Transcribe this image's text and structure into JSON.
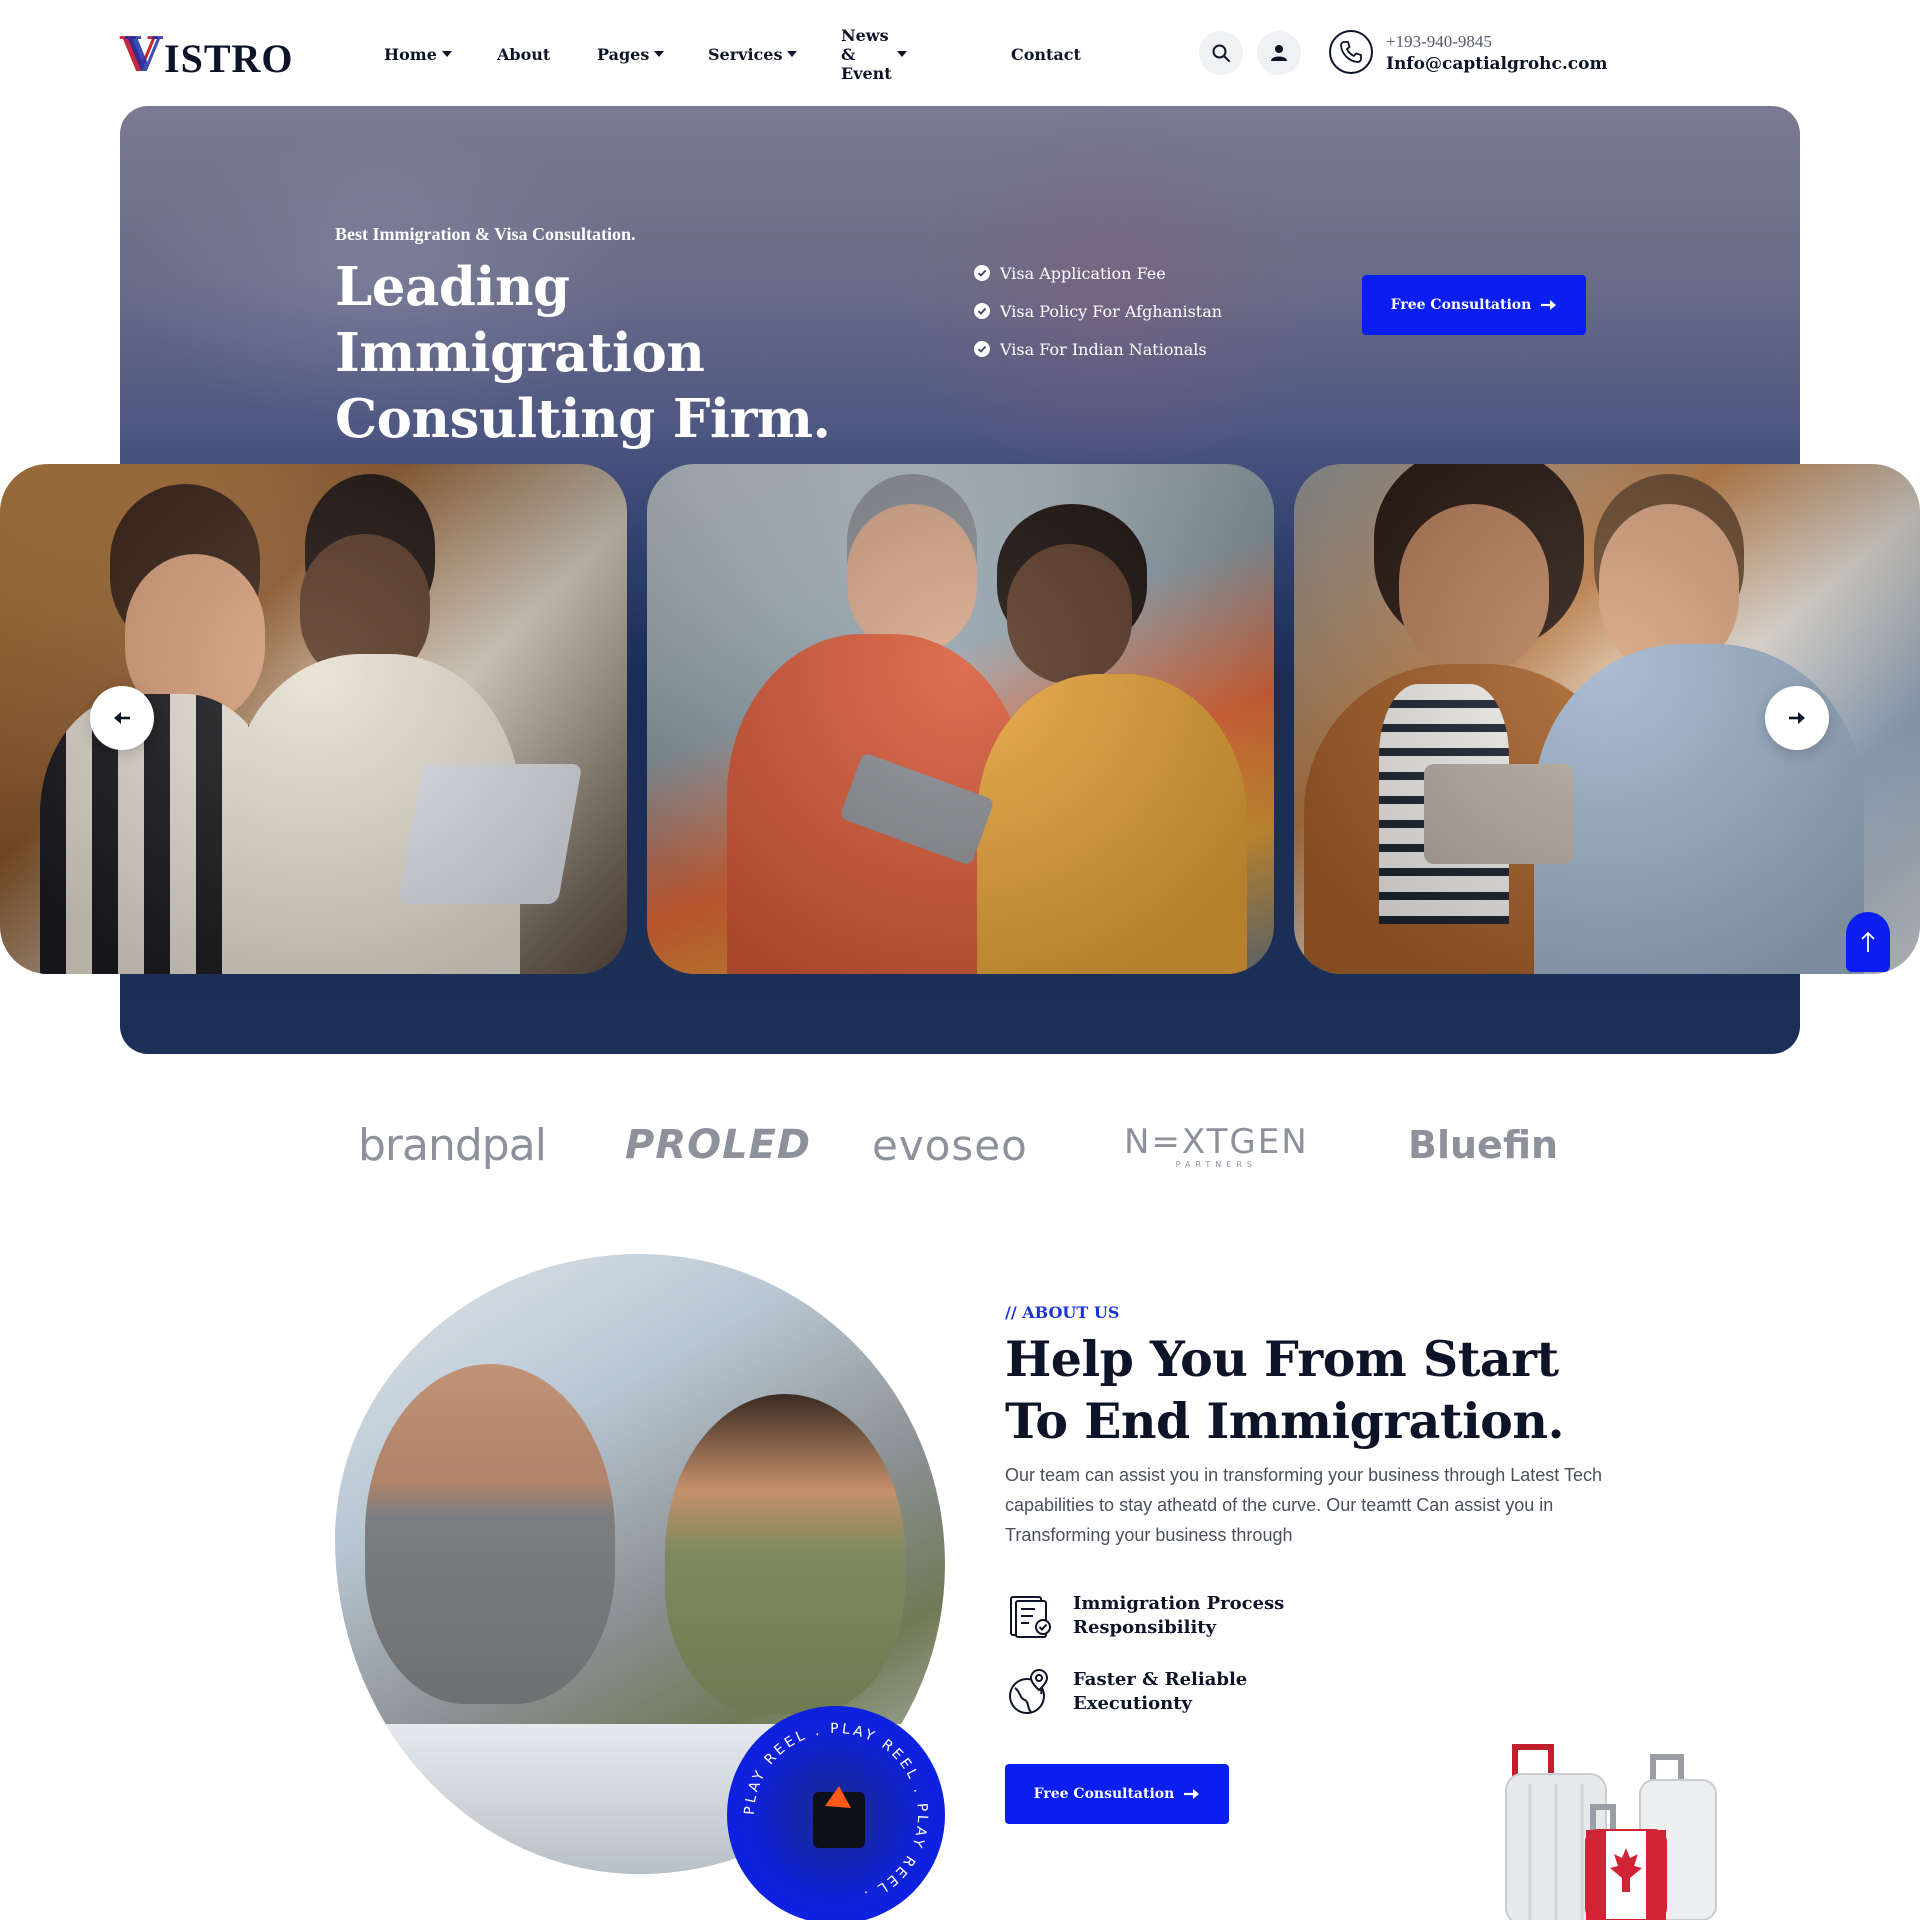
{
  "brand": {
    "logo_mark": "V",
    "logo_word": "ISTRO"
  },
  "nav": {
    "items": [
      {
        "label": "Home",
        "dropdown": true
      },
      {
        "label": "About",
        "dropdown": false
      },
      {
        "label": "Pages",
        "dropdown": true
      },
      {
        "label": "Services",
        "dropdown": true
      },
      {
        "label": "News & Event",
        "dropdown": true
      },
      {
        "label": "Contact",
        "dropdown": false
      }
    ]
  },
  "header": {
    "icons": [
      "search-icon",
      "user-icon",
      "phone-icon"
    ],
    "phone": "+193-940-9845",
    "email": "Info@captialgrohc.com"
  },
  "hero": {
    "kicker": "Best Immigration & Visa Consultation.",
    "title": "Leading Immigration Consulting Firm.",
    "list": [
      "Visa Application Fee",
      "Visa Policy For Afghanistan",
      "Visa For Indian Nationals"
    ],
    "cta_label": "Free Consultation"
  },
  "slider": {
    "cards": [
      "team-photo-laptop",
      "team-photo-tablet",
      "couple-photo-tablet"
    ],
    "prev_icon": "arrow-left-icon",
    "next_icon": "arrow-right-icon"
  },
  "brands": {
    "logos": [
      "brandpal",
      "PROLED",
      "evoseo",
      "N=XTGEN",
      "PARTNERS",
      "Bluefin"
    ]
  },
  "about": {
    "kicker": "// ABOUT US",
    "title": "Help You From Start To End Immigration.",
    "text": "Our team can assist you in transforming your business through Latest Tech capabilities to stay atheatd of the curve. Our teamtt Can assist you in Transforming your business through",
    "features": [
      {
        "icon": "document-check-icon",
        "label": "Immigration Process Responsibility"
      },
      {
        "icon": "globe-location-icon",
        "label": "Faster & Reliable Executionty"
      }
    ],
    "cta_label": "Free Consultation",
    "badge_text": "PLAY REEL . PLAY REEL . PLAY REEL ."
  },
  "colors": {
    "accent": "#0a1ef0",
    "navy": "#1b2f57",
    "heading": "#0e1428",
    "logo_red": "#c8263a"
  }
}
